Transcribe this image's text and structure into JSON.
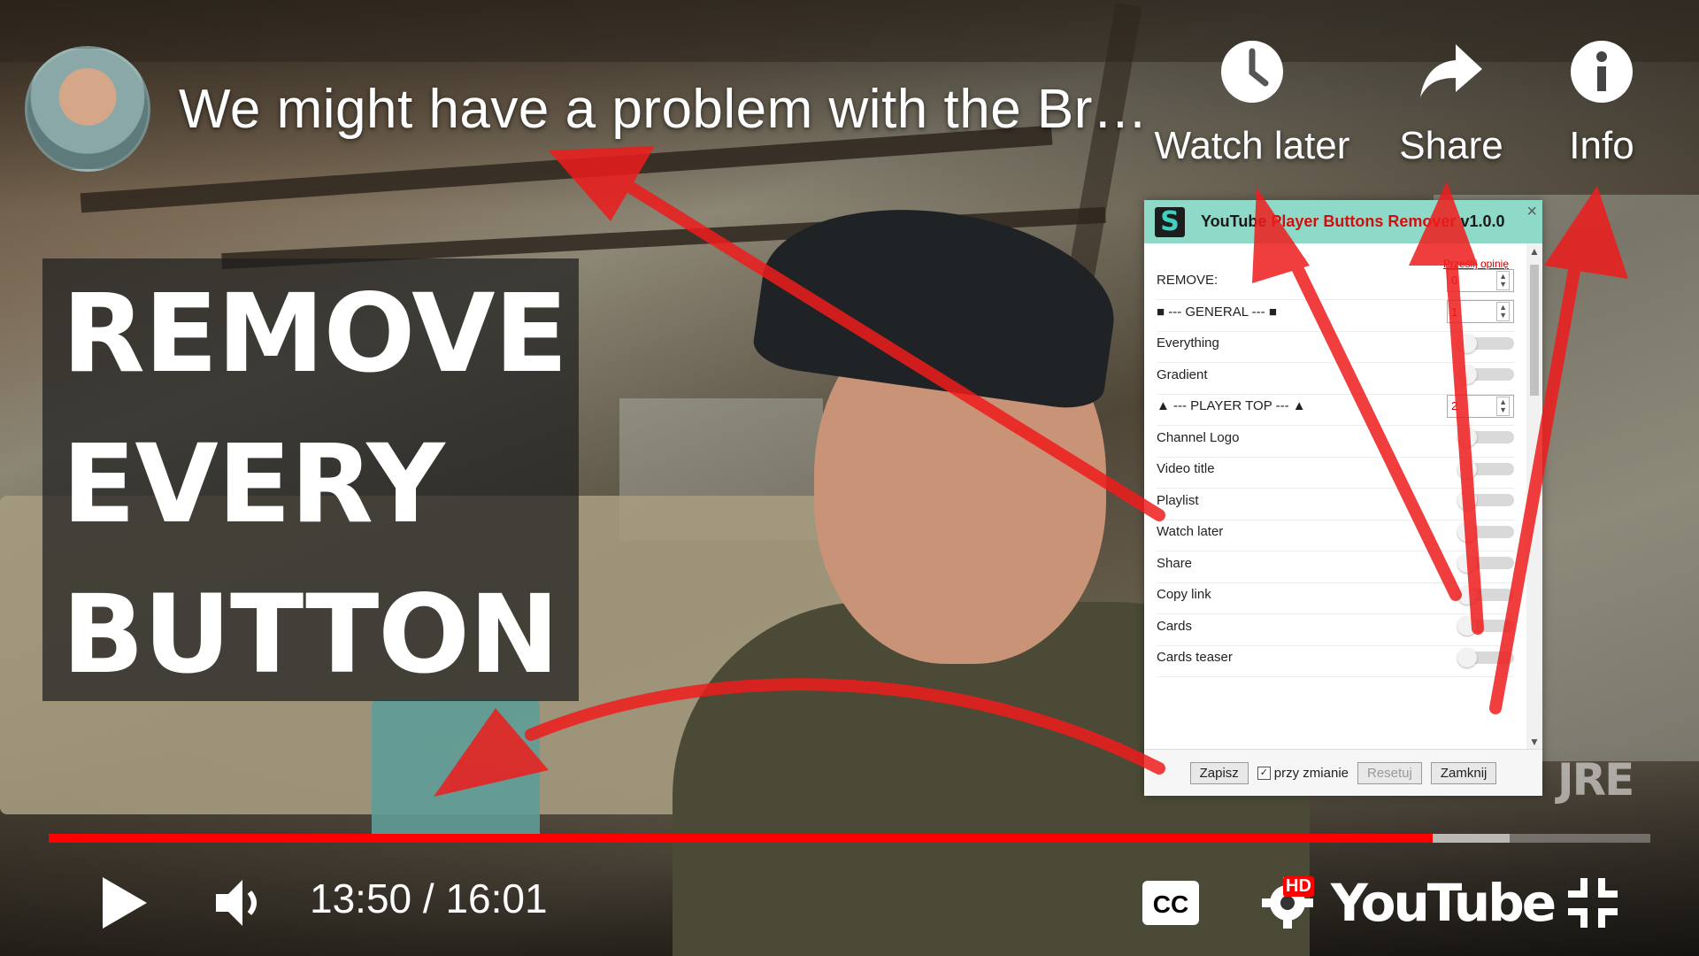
{
  "video": {
    "title": "We might have a problem with the Br…"
  },
  "top_actions": {
    "watch_later": "Watch later",
    "share": "Share",
    "info": "Info"
  },
  "overlay_text": {
    "line1": "REMOVE",
    "line2": "EVERY",
    "line3": "BUTTON"
  },
  "popup": {
    "logo_letter": "S",
    "title_part1": "YouTube",
    "title_part2": "Player Buttons Remover",
    "title_version": "v1.0.0",
    "close": "×",
    "feedback_link": "Prześlij opinię",
    "rows": [
      {
        "label": "REMOVE:",
        "kind": "number",
        "value": "0"
      },
      {
        "label": "■ --- GENERAL --- ■",
        "kind": "number",
        "value": "1"
      },
      {
        "label": "Everything",
        "kind": "toggle"
      },
      {
        "label": "Gradient",
        "kind": "toggle"
      },
      {
        "label": "▲ --- PLAYER TOP --- ▲",
        "kind": "number",
        "value": "2"
      },
      {
        "label": "Channel Logo",
        "kind": "toggle"
      },
      {
        "label": "Video title",
        "kind": "toggle"
      },
      {
        "label": "Playlist",
        "kind": "toggle"
      },
      {
        "label": "Watch later",
        "kind": "toggle"
      },
      {
        "label": "Share",
        "kind": "toggle"
      },
      {
        "label": "Copy link",
        "kind": "toggle"
      },
      {
        "label": "Cards",
        "kind": "toggle"
      },
      {
        "label": "Cards teaser",
        "kind": "toggle"
      }
    ],
    "footer": {
      "save": "Zapisz",
      "on_change_checked": true,
      "on_change_label": "przy zmianie",
      "reset": "Resetuj",
      "close": "Zamknij"
    }
  },
  "watermark": "JRE",
  "player": {
    "time_display": "13:50 / 16:01",
    "progress_played_fraction": 0.864,
    "progress_buffer_fraction": 0.912,
    "logo": "YouTube",
    "hd_badge": "HD",
    "cc_label": "CC"
  },
  "icons": [
    "clock-icon",
    "share-arrow-icon",
    "info-icon",
    "play-icon",
    "volume-icon",
    "cc-icon",
    "gear-icon",
    "fullscreen-exit-icon"
  ],
  "colors": {
    "progress": "#ff0000",
    "arrows": "#ee1c1c",
    "popup_header": "#8ed9c8"
  }
}
